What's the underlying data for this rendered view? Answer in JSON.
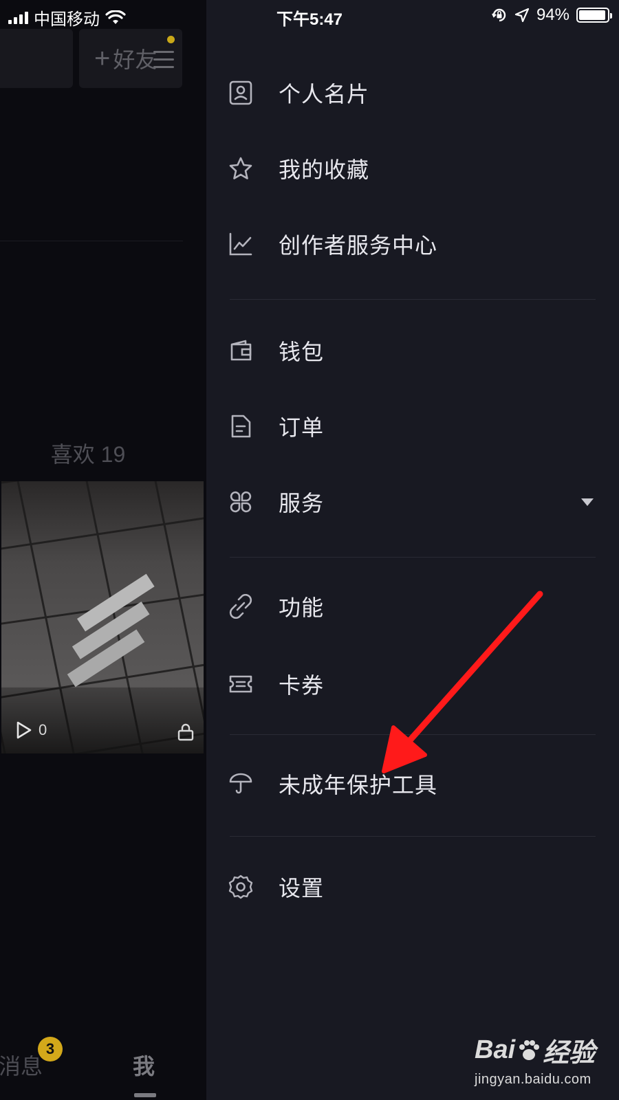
{
  "status_bar": {
    "carrier": "中国移动",
    "time": "下午5:47",
    "battery": "94%",
    "battery_level": 0.94
  },
  "profile_bg": {
    "add_friend_label": "好友",
    "likes_label": "喜欢 19",
    "thumb_play_count": "0",
    "tabs": {
      "messages_label": "消息",
      "messages_badge": "3",
      "me_label": "我"
    }
  },
  "drawer": {
    "items": [
      {
        "label": "个人名片",
        "icon": "profile-card-icon"
      },
      {
        "label": "我的收藏",
        "icon": "star-icon"
      },
      {
        "label": "创作者服务中心",
        "icon": "chart-line-icon"
      },
      {
        "label": "钱包",
        "icon": "wallet-icon"
      },
      {
        "label": "订单",
        "icon": "order-document-icon"
      },
      {
        "label": "服务",
        "icon": "four-petal-grid-icon"
      },
      {
        "label": "功能",
        "icon": "link-icon"
      },
      {
        "label": "卡券",
        "icon": "ticket-icon"
      },
      {
        "label": "未成年保护工具",
        "icon": "umbrella-icon"
      },
      {
        "label": "设置",
        "icon": "gear-icon"
      }
    ]
  },
  "colors": {
    "drawer_bg": "#181922",
    "page_bg": "#0b0b10",
    "badge": "#d3a81a",
    "arrow": "#ff1a1a"
  },
  "watermark": {
    "logo_text_a": "Bai",
    "logo_text_b": "经验",
    "url": "jingyan.baidu.com"
  }
}
